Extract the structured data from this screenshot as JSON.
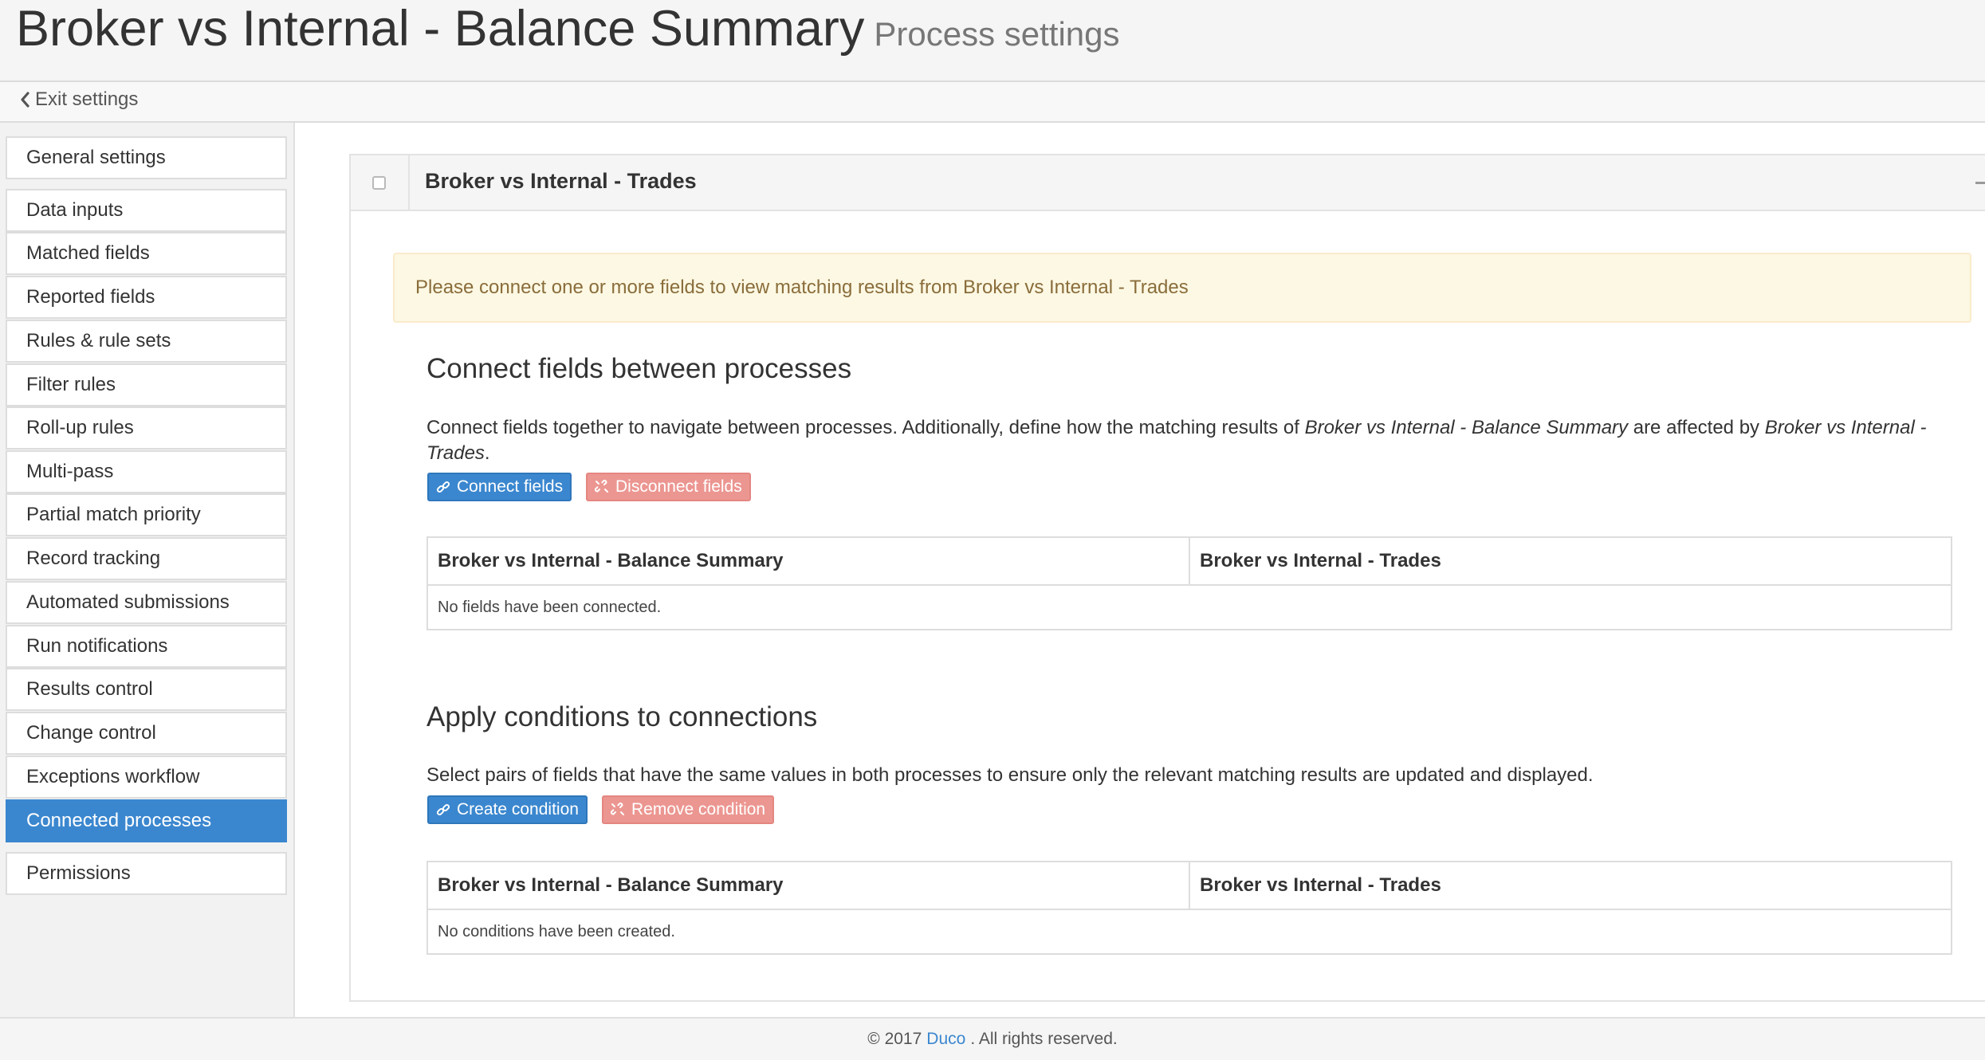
{
  "header": {
    "title": "Broker vs Internal - Balance Summary",
    "subtitle": "Process settings"
  },
  "exit_settings": {
    "label": "Exit settings",
    "icon": "chevron-left-icon"
  },
  "sidebar": {
    "items": [
      {
        "label": "General settings",
        "active": false
      },
      {
        "label": "Data inputs",
        "active": false
      },
      {
        "label": "Matched fields",
        "active": false
      },
      {
        "label": "Reported fields",
        "active": false
      },
      {
        "label": "Rules & rule sets",
        "active": false
      },
      {
        "label": "Filter rules",
        "active": false
      },
      {
        "label": "Roll-up rules",
        "active": false
      },
      {
        "label": "Multi-pass",
        "active": false
      },
      {
        "label": "Partial match priority",
        "active": false
      },
      {
        "label": "Record tracking",
        "active": false
      },
      {
        "label": "Automated submissions",
        "active": false
      },
      {
        "label": "Run notifications",
        "active": false
      },
      {
        "label": "Results control",
        "active": false
      },
      {
        "label": "Change control",
        "active": false
      },
      {
        "label": "Exceptions workflow",
        "active": false
      },
      {
        "label": "Connected processes",
        "active": true
      },
      {
        "label": "Permissions",
        "active": false
      }
    ]
  },
  "panel": {
    "title": "Broker vs Internal - Trades",
    "alert": "Please connect one or more fields to view matching results from Broker vs Internal - Trades"
  },
  "connect_section": {
    "heading": "Connect fields between processes",
    "desc_part1": "Connect fields together to navigate between processes. Additionally, define how the matching results of ",
    "desc_em1": "Broker vs Internal - Balance Summary",
    "desc_part2": " are affected by ",
    "desc_em2": "Broker vs Internal - Trades",
    "desc_part3": ".",
    "connect_button": "Connect fields",
    "disconnect_button": "Disconnect fields",
    "table": {
      "columns": [
        "Broker vs Internal - Balance Summary",
        "Broker vs Internal - Trades"
      ],
      "empty_message": "No fields have been connected."
    }
  },
  "conditions_section": {
    "heading": "Apply conditions to connections",
    "desc": "Select pairs of fields that have the same values in both processes to ensure only the relevant matching results are updated and displayed.",
    "create_button": "Create condition",
    "remove_button": "Remove condition",
    "table": {
      "columns": [
        "Broker vs Internal - Balance Summary",
        "Broker vs Internal - Trades"
      ],
      "empty_message": "No conditions have been created."
    }
  },
  "footer": {
    "copyright": "© 2017",
    "link": "Duco",
    "suffix": ". All rights reserved."
  },
  "colors": {
    "primary": "#3b87cf",
    "danger_disabled": "#ec9691",
    "alert_bg": "#fcf8e3",
    "alert_text": "#8a6d3b"
  }
}
